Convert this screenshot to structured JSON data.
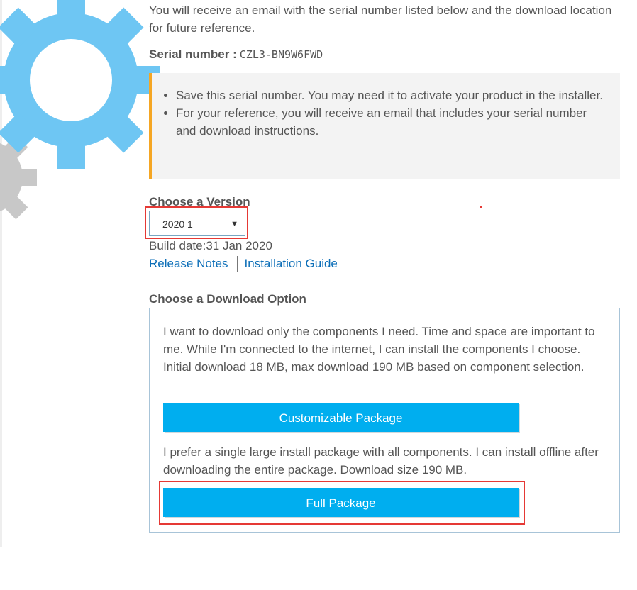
{
  "intro_text": "You will receive an email with the serial number listed below and the download location for future reference.",
  "serial": {
    "label": "Serial number :",
    "value": "CZL3-BN9W6FWD"
  },
  "notice": {
    "items": [
      "Save this serial number. You may need it to activate your product in the installer.",
      "For your reference, you will receive an email that includes your serial number and download instructions."
    ],
    "accent_color": "#f5a623"
  },
  "version": {
    "heading": "Choose a Version",
    "selected": "2020 1",
    "build_date": "Build date:31 Jan 2020",
    "links": {
      "release_notes": "Release Notes",
      "installation_guide": "Installation Guide"
    }
  },
  "download": {
    "heading": "Choose a Download Option",
    "option1_text": "I want to download only the components I need. Time and space are important to me. While I'm connected to the internet, I can install the components I choose. Initial download 18 MB, max download 190 MB based on component selection.",
    "option1_button": "Customizable Package",
    "option2_text": "I prefer a single large install package with all components. I can install offline after downloading the entire package. Download size 190 MB.",
    "option2_button": "Full Package"
  },
  "colors": {
    "button": "#00aeef",
    "link": "#0d6fb8",
    "highlight": "#e53935",
    "gear_blue": "#6ec6f3",
    "gear_gray": "#c8c8c8"
  },
  "icons": {
    "gear_art": "gear-icon",
    "dropdown_caret": "chevron-down-icon"
  }
}
